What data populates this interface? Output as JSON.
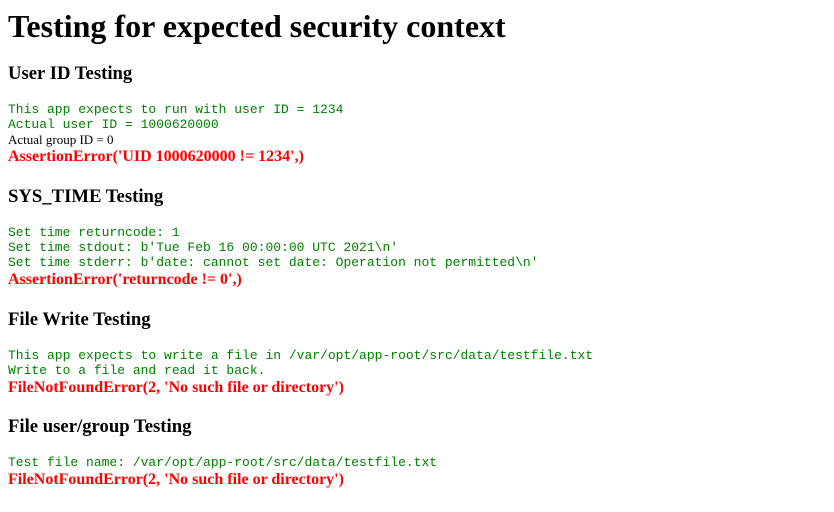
{
  "page": {
    "title": "Testing for expected security context"
  },
  "sections": [
    {
      "heading": "User ID Testing",
      "lines": [
        "This app expects to run with user ID = 1234",
        "Actual user ID = 1000620000"
      ],
      "plain_line": "Actual group ID = 0",
      "error": "AssertionError('UID 1000620000 != 1234',)"
    },
    {
      "heading": "SYS_TIME Testing",
      "lines": [
        "Set time returncode: 1",
        "Set time stdout: b'Tue Feb 16 00:00:00 UTC 2021\\n'",
        "Set time stderr: b'date: cannot set date: Operation not permitted\\n'"
      ],
      "error": "AssertionError('returncode != 0',)"
    },
    {
      "heading": "File Write Testing",
      "lines": [
        "This app expects to write a file in /var/opt/app-root/src/data/testfile.txt",
        "Write to a file and read it back."
      ],
      "error": "FileNotFoundError(2, 'No such file or directory')"
    },
    {
      "heading": "File user/group Testing",
      "lines": [
        "Test file name: /var/opt/app-root/src/data/testfile.txt"
      ],
      "error": "FileNotFoundError(2, 'No such file or directory')"
    }
  ],
  "colors": {
    "output_text": "#008000",
    "error_text": "#ff0000",
    "heading_text": "#000000"
  }
}
